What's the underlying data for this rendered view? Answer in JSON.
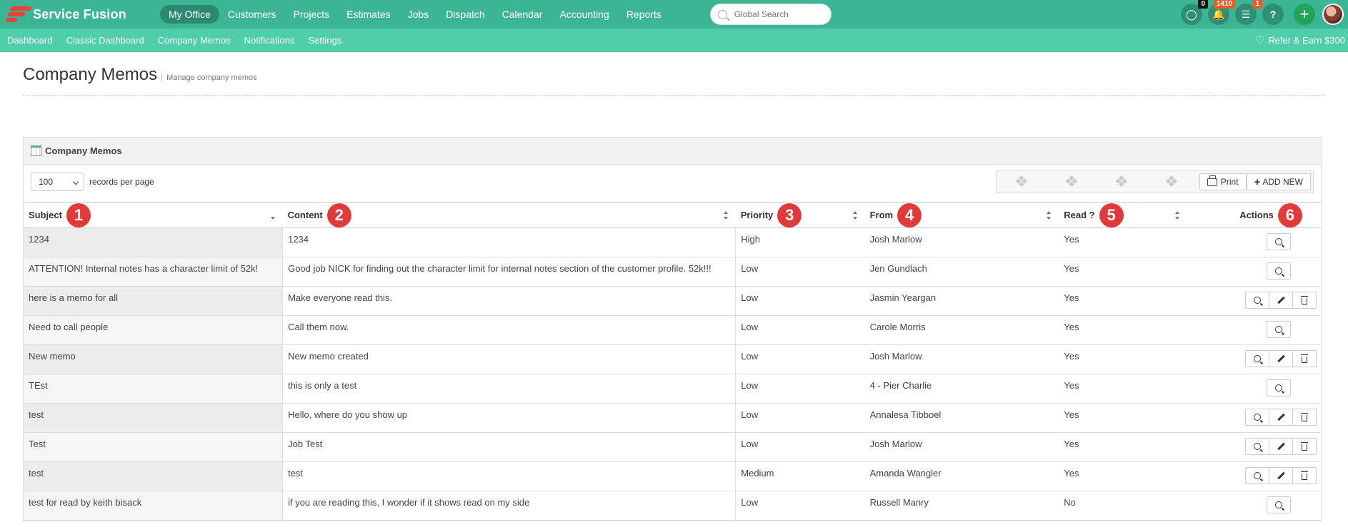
{
  "app": {
    "name": "Service Fusion"
  },
  "topnav": [
    {
      "label": "My Office",
      "active": true
    },
    {
      "label": "Customers"
    },
    {
      "label": "Projects"
    },
    {
      "label": "Estimates"
    },
    {
      "label": "Jobs"
    },
    {
      "label": "Dispatch"
    },
    {
      "label": "Calendar"
    },
    {
      "label": "Accounting"
    },
    {
      "label": "Reports"
    }
  ],
  "search": {
    "placeholder": "Global Search"
  },
  "top_icons": {
    "chat_badge": "0",
    "notifications_badge": "1410",
    "tasks_badge": "1",
    "help": "?",
    "add": "+"
  },
  "subnav": [
    "Dashboard",
    "Classic Dashboard",
    "Company Memos",
    "Notifications",
    "Settings"
  ],
  "refer": "Refer & Earn $300",
  "page": {
    "title": "Company Memos",
    "subtitle": "Manage company memos"
  },
  "panel": {
    "title": "Company Memos",
    "records_per_page_value": "100",
    "records_per_page_label": "records per page",
    "print_label": "Print",
    "add_new_label": "ADD NEW"
  },
  "table": {
    "columns": [
      {
        "label": "Subject",
        "marker": "1"
      },
      {
        "label": "Content",
        "marker": "2"
      },
      {
        "label": "Priority",
        "marker": "3"
      },
      {
        "label": "From",
        "marker": "4"
      },
      {
        "label": "Read ?",
        "marker": "5"
      },
      {
        "label": "Actions",
        "marker": "6"
      }
    ],
    "rows": [
      {
        "subject": "1234",
        "content": "1234",
        "priority": "High",
        "from": "Josh Marlow",
        "read": "Yes",
        "editable": false
      },
      {
        "subject": "ATTENTION! Internal notes has a character limit of 52k!",
        "content": "Good job NICK for finding out the character limit for internal notes section of the customer profile. 52k!!!",
        "priority": "Low",
        "from": "Jen Gundlach",
        "read": "Yes",
        "editable": false
      },
      {
        "subject": "here is a memo for all",
        "content": "Make everyone read this.",
        "priority": "Low",
        "from": "Jasmin Yeargan",
        "read": "Yes",
        "editable": true
      },
      {
        "subject": "Need to call people",
        "content": "Call them now.",
        "priority": "Low",
        "from": "Carole Morris",
        "read": "Yes",
        "editable": false
      },
      {
        "subject": "New memo",
        "content": "New memo created",
        "priority": "Low",
        "from": "Josh Marlow",
        "read": "Yes",
        "editable": true
      },
      {
        "subject": "TEst",
        "content": "this is only a test",
        "priority": "Low",
        "from": "4 - Pier Charlie",
        "read": "Yes",
        "editable": false
      },
      {
        "subject": "test",
        "content": "Hello, where do you show up",
        "priority": "Low",
        "from": "Annalesa Tibboel",
        "read": "Yes",
        "editable": true
      },
      {
        "subject": "Test",
        "content": "Job Test",
        "priority": "Low",
        "from": "Josh Marlow",
        "read": "Yes",
        "editable": true
      },
      {
        "subject": "test",
        "content": "test",
        "priority": "Medium",
        "from": "Amanda Wangler",
        "read": "Yes",
        "editable": true
      },
      {
        "subject": "test for read by keith bisack",
        "content": "if you are reading this, I wonder if it shows read on my side",
        "priority": "Low",
        "from": "Russell Manry",
        "read": "No",
        "editable": false
      }
    ]
  },
  "colors": {
    "topbar": "#3cb594",
    "subnav": "#4ecfa9",
    "marker": "#e23a3a",
    "logo": "#e8413b"
  }
}
